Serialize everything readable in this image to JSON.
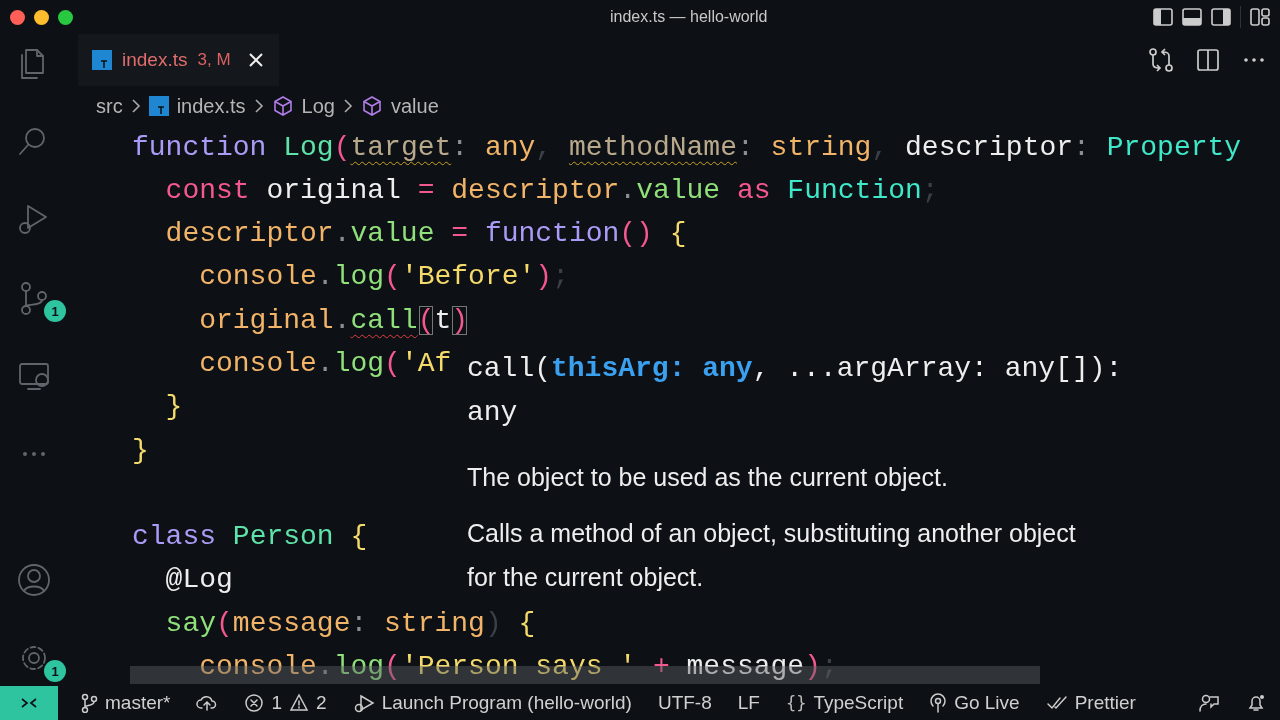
{
  "window": {
    "title": "index.ts — hello-world"
  },
  "activity_bar": {
    "items": [
      {
        "kind": "files"
      },
      {
        "kind": "search"
      },
      {
        "kind": "run"
      },
      {
        "kind": "source-control",
        "badge": "1"
      },
      {
        "kind": "remote"
      },
      {
        "kind": "more"
      }
    ],
    "bottom_items": [
      {
        "kind": "account"
      },
      {
        "kind": "settings",
        "badge": "1"
      }
    ]
  },
  "tabs": [
    {
      "label": "index.ts",
      "status": "3, M",
      "selected": true
    }
  ],
  "breadcrumb": [
    {
      "label": "src",
      "kind": "folder"
    },
    {
      "label": "index.ts",
      "kind": "file"
    },
    {
      "label": "Log",
      "kind": "symbol"
    },
    {
      "label": "value",
      "kind": "symbol"
    }
  ],
  "editor": {
    "lines": [
      {
        "kind": "code",
        "tokens": [
          {
            "text": "function ",
            "kind": "keyword"
          },
          {
            "text": "Log",
            "kind": "function"
          },
          {
            "text": "(",
            "kind": "paren"
          },
          {
            "text": "target",
            "kind": "unused",
            "warning": true
          },
          {
            "text": ":",
            "kind": "punct"
          },
          {
            "text": " any",
            "kind": "type"
          },
          {
            "text": ", ",
            "kind": "faint"
          },
          {
            "text": "methodName",
            "kind": "unused",
            "warning": true
          },
          {
            "text": ":",
            "kind": "punct"
          },
          {
            "text": " string",
            "kind": "type"
          },
          {
            "text": ",",
            "kind": "faint"
          },
          {
            "text": " descriptor",
            "kind": "plain"
          },
          {
            "text": ":",
            "kind": "punct"
          },
          {
            "text": " Property",
            "kind": "class"
          }
        ]
      },
      {
        "kind": "code",
        "tokens": [
          {
            "text": "  const",
            "kind": "operator"
          },
          {
            "text": " original ",
            "kind": "plain"
          },
          {
            "text": "=",
            "kind": "operator"
          },
          {
            "text": " descriptor",
            "kind": "variable"
          },
          {
            "text": ".",
            "kind": "punct"
          },
          {
            "text": "value",
            "kind": "member"
          },
          {
            "text": " as",
            "kind": "operator"
          },
          {
            "text": " Function",
            "kind": "class"
          },
          {
            "text": ";",
            "kind": "faint"
          }
        ]
      },
      {
        "kind": "code",
        "tokens": [
          {
            "text": "  descriptor",
            "kind": "variable"
          },
          {
            "text": ".",
            "kind": "punct"
          },
          {
            "text": "value",
            "kind": "member"
          },
          {
            "text": " =",
            "kind": "operator"
          },
          {
            "text": " function",
            "kind": "keyword"
          },
          {
            "text": "()",
            "kind": "paren"
          },
          {
            "text": " {",
            "kind": "brace"
          }
        ]
      },
      {
        "kind": "code",
        "tokens": [
          {
            "text": "    console",
            "kind": "variable"
          },
          {
            "text": ".",
            "kind": "punct"
          },
          {
            "text": "log",
            "kind": "member"
          },
          {
            "text": "(",
            "kind": "paren"
          },
          {
            "text": "'Before'",
            "kind": "string"
          },
          {
            "text": ")",
            "kind": "paren"
          },
          {
            "text": ";",
            "kind": "faint"
          }
        ]
      },
      {
        "kind": "code",
        "tokens": [
          {
            "text": "    original",
            "kind": "variable"
          },
          {
            "text": ".",
            "kind": "punct"
          },
          {
            "text": "call",
            "kind": "member",
            "error": true
          },
          {
            "text": "(",
            "kind": "paren",
            "boxed": true
          },
          {
            "text": "t",
            "kind": "plain"
          },
          {
            "text": ")",
            "kind": "paren",
            "boxed": true
          }
        ]
      },
      {
        "kind": "code",
        "tokens": [
          {
            "text": "    console",
            "kind": "variable"
          },
          {
            "text": ".",
            "kind": "punct"
          },
          {
            "text": "log",
            "kind": "member"
          },
          {
            "text": "(",
            "kind": "paren"
          },
          {
            "text": "'Af",
            "kind": "string"
          }
        ]
      },
      {
        "kind": "code",
        "tokens": [
          {
            "text": "  }",
            "kind": "brace"
          }
        ]
      },
      {
        "kind": "code",
        "tokens": [
          {
            "text": "}",
            "kind": "brace"
          }
        ]
      },
      {
        "kind": "blank"
      },
      {
        "kind": "code",
        "tokens": [
          {
            "text": "class ",
            "kind": "keyword"
          },
          {
            "text": "Person",
            "kind": "function"
          },
          {
            "text": " {",
            "kind": "brace"
          }
        ]
      },
      {
        "kind": "code",
        "tokens": [
          {
            "text": "  @Log",
            "kind": "plain"
          }
        ]
      },
      {
        "kind": "code",
        "tokens": [
          {
            "text": "  say",
            "kind": "member"
          },
          {
            "text": "(",
            "kind": "paren"
          },
          {
            "text": "message",
            "kind": "variable"
          },
          {
            "text": ":",
            "kind": "punct"
          },
          {
            "text": " string",
            "kind": "type"
          },
          {
            "text": ")",
            "kind": "faint"
          },
          {
            "text": " {",
            "kind": "brace"
          }
        ]
      },
      {
        "kind": "code",
        "tokens": [
          {
            "text": "    console",
            "kind": "variable"
          },
          {
            "text": ".",
            "kind": "punct"
          },
          {
            "text": "log",
            "kind": "member"
          },
          {
            "text": "(",
            "kind": "paren"
          },
          {
            "text": "'Person says '",
            "kind": "string"
          },
          {
            "text": " +",
            "kind": "operator"
          },
          {
            "text": " message",
            "kind": "plain"
          },
          {
            "text": ")",
            "kind": "paren"
          },
          {
            "text": ";",
            "kind": "faint"
          }
        ]
      }
    ]
  },
  "hover": {
    "signature": "call(**thisArg: any**, ...argArray: any[]): any",
    "paragraphs": [
      "The object to be used as the current object.",
      "Calls a method of an object, substituting another object for the current object."
    ]
  },
  "status_bar": {
    "items": [
      {
        "kind": "branch",
        "label": "master*"
      },
      {
        "kind": "sync"
      },
      {
        "kind": "problems",
        "errors": "1",
        "warnings": "2"
      },
      {
        "kind": "debug",
        "label": "Launch Program (hello-world)"
      },
      {
        "kind": "text",
        "label": "UTF-8"
      },
      {
        "kind": "text",
        "label": "LF"
      },
      {
        "kind": "language",
        "glyph": "{}",
        "label": "TypeScript"
      },
      {
        "kind": "live",
        "label": "Go Live"
      },
      {
        "kind": "prettier",
        "label": "Prettier"
      },
      {
        "kind": "feedback"
      },
      {
        "kind": "bell"
      }
    ]
  }
}
